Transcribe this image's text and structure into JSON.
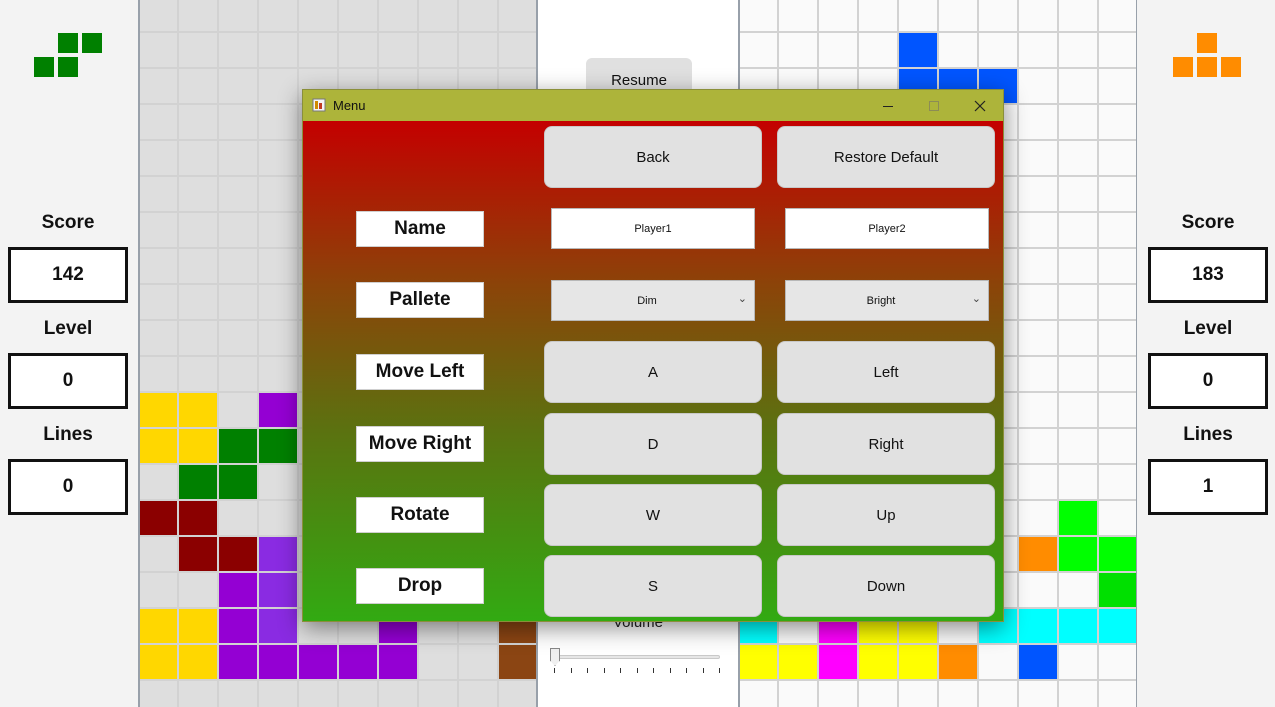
{
  "colors": {
    "green": "#008000",
    "orange": "#ff8c00",
    "yellow": "#ffd700",
    "purple": "#8a2be2",
    "violet": "#9400d3",
    "darkred": "#8b0000",
    "brown": "#8b4513",
    "blue": "#0055ff",
    "cyan": "#00ffff",
    "magenta": "#ff00ff",
    "lime": "#00ff00",
    "brightyellow": "#ffff00",
    "greenbright": "#00e000"
  },
  "player1": {
    "score_label": "Score",
    "score": "142",
    "level_label": "Level",
    "level": "0",
    "lines_label": "Lines",
    "lines": "0",
    "next_piece": "S",
    "next_color": "#008000"
  },
  "player2": {
    "score_label": "Score",
    "score": "183",
    "level_label": "Level",
    "level": "0",
    "lines_label": "Lines",
    "lines": "1",
    "next_piece": "T",
    "next_color": "#ff8c00"
  },
  "board1": {
    "background": "#dedede",
    "cells": [
      {
        "r": 11,
        "c": 0,
        "k": "yellow"
      },
      {
        "r": 11,
        "c": 1,
        "k": "yellow"
      },
      {
        "r": 11,
        "c": 3,
        "k": "violet"
      },
      {
        "r": 12,
        "c": 0,
        "k": "yellow"
      },
      {
        "r": 12,
        "c": 1,
        "k": "yellow"
      },
      {
        "r": 12,
        "c": 2,
        "k": "green"
      },
      {
        "r": 12,
        "c": 3,
        "k": "green"
      },
      {
        "r": 13,
        "c": 1,
        "k": "green"
      },
      {
        "r": 13,
        "c": 2,
        "k": "green"
      },
      {
        "r": 14,
        "c": 0,
        "k": "darkred"
      },
      {
        "r": 14,
        "c": 1,
        "k": "darkred"
      },
      {
        "r": 15,
        "c": 1,
        "k": "darkred"
      },
      {
        "r": 15,
        "c": 2,
        "k": "darkred"
      },
      {
        "r": 15,
        "c": 3,
        "k": "purple"
      },
      {
        "r": 16,
        "c": 2,
        "k": "violet"
      },
      {
        "r": 16,
        "c": 3,
        "k": "purple"
      },
      {
        "r": 16,
        "c": 9,
        "k": "brown"
      },
      {
        "r": 17,
        "c": 0,
        "k": "yellow"
      },
      {
        "r": 17,
        "c": 1,
        "k": "yellow"
      },
      {
        "r": 17,
        "c": 2,
        "k": "violet"
      },
      {
        "r": 17,
        "c": 3,
        "k": "purple"
      },
      {
        "r": 17,
        "c": 6,
        "k": "violet"
      },
      {
        "r": 17,
        "c": 9,
        "k": "brown"
      },
      {
        "r": 18,
        "c": 0,
        "k": "yellow"
      },
      {
        "r": 18,
        "c": 1,
        "k": "yellow"
      },
      {
        "r": 18,
        "c": 2,
        "k": "violet"
      },
      {
        "r": 18,
        "c": 3,
        "k": "violet"
      },
      {
        "r": 18,
        "c": 4,
        "k": "violet"
      },
      {
        "r": 18,
        "c": 5,
        "k": "violet"
      },
      {
        "r": 18,
        "c": 6,
        "k": "violet"
      },
      {
        "r": 18,
        "c": 9,
        "k": "brown"
      }
    ]
  },
  "board2": {
    "background": "#fafafa",
    "cells": [
      {
        "r": 1,
        "c": 4,
        "k": "blue"
      },
      {
        "r": 2,
        "c": 4,
        "k": "blue"
      },
      {
        "r": 2,
        "c": 5,
        "k": "blue"
      },
      {
        "r": 2,
        "c": 6,
        "k": "blue"
      },
      {
        "r": 14,
        "c": 8,
        "k": "lime"
      },
      {
        "r": 15,
        "c": 7,
        "k": "orange"
      },
      {
        "r": 15,
        "c": 8,
        "k": "lime"
      },
      {
        "r": 15,
        "c": 9,
        "k": "lime"
      },
      {
        "r": 16,
        "c": 9,
        "k": "greenbright"
      },
      {
        "r": 17,
        "c": 0,
        "k": "cyan"
      },
      {
        "r": 17,
        "c": 2,
        "k": "magenta"
      },
      {
        "r": 17,
        "c": 3,
        "k": "brightyellow"
      },
      {
        "r": 17,
        "c": 4,
        "k": "brightyellow"
      },
      {
        "r": 17,
        "c": 6,
        "k": "cyan"
      },
      {
        "r": 17,
        "c": 7,
        "k": "cyan"
      },
      {
        "r": 17,
        "c": 8,
        "k": "cyan"
      },
      {
        "r": 17,
        "c": 9,
        "k": "cyan"
      },
      {
        "r": 18,
        "c": 0,
        "k": "brightyellow"
      },
      {
        "r": 18,
        "c": 1,
        "k": "brightyellow"
      },
      {
        "r": 18,
        "c": 2,
        "k": "magenta"
      },
      {
        "r": 18,
        "c": 3,
        "k": "brightyellow"
      },
      {
        "r": 18,
        "c": 4,
        "k": "brightyellow"
      },
      {
        "r": 18,
        "c": 5,
        "k": "orange"
      },
      {
        "r": 18,
        "c": 7,
        "k": "blue"
      }
    ]
  },
  "middle": {
    "resume_label": "Resume",
    "volume_label": "Volume",
    "volume_value": 0
  },
  "dialog": {
    "title": "Menu",
    "back_label": "Back",
    "restore_label": "Restore Default",
    "rows": {
      "name": "Name",
      "pallete": "Pallete",
      "move_left": "Move Left",
      "move_right": "Move Right",
      "rotate": "Rotate",
      "drop": "Drop"
    },
    "p1": {
      "name": "Player1",
      "pallete": "Dim",
      "left": "A",
      "right": "D",
      "rotate": "W",
      "drop": "S"
    },
    "p2": {
      "name": "Player2",
      "pallete": "Bright",
      "left": "Left",
      "right": "Right",
      "rotate": "Up",
      "drop": "Down"
    }
  }
}
